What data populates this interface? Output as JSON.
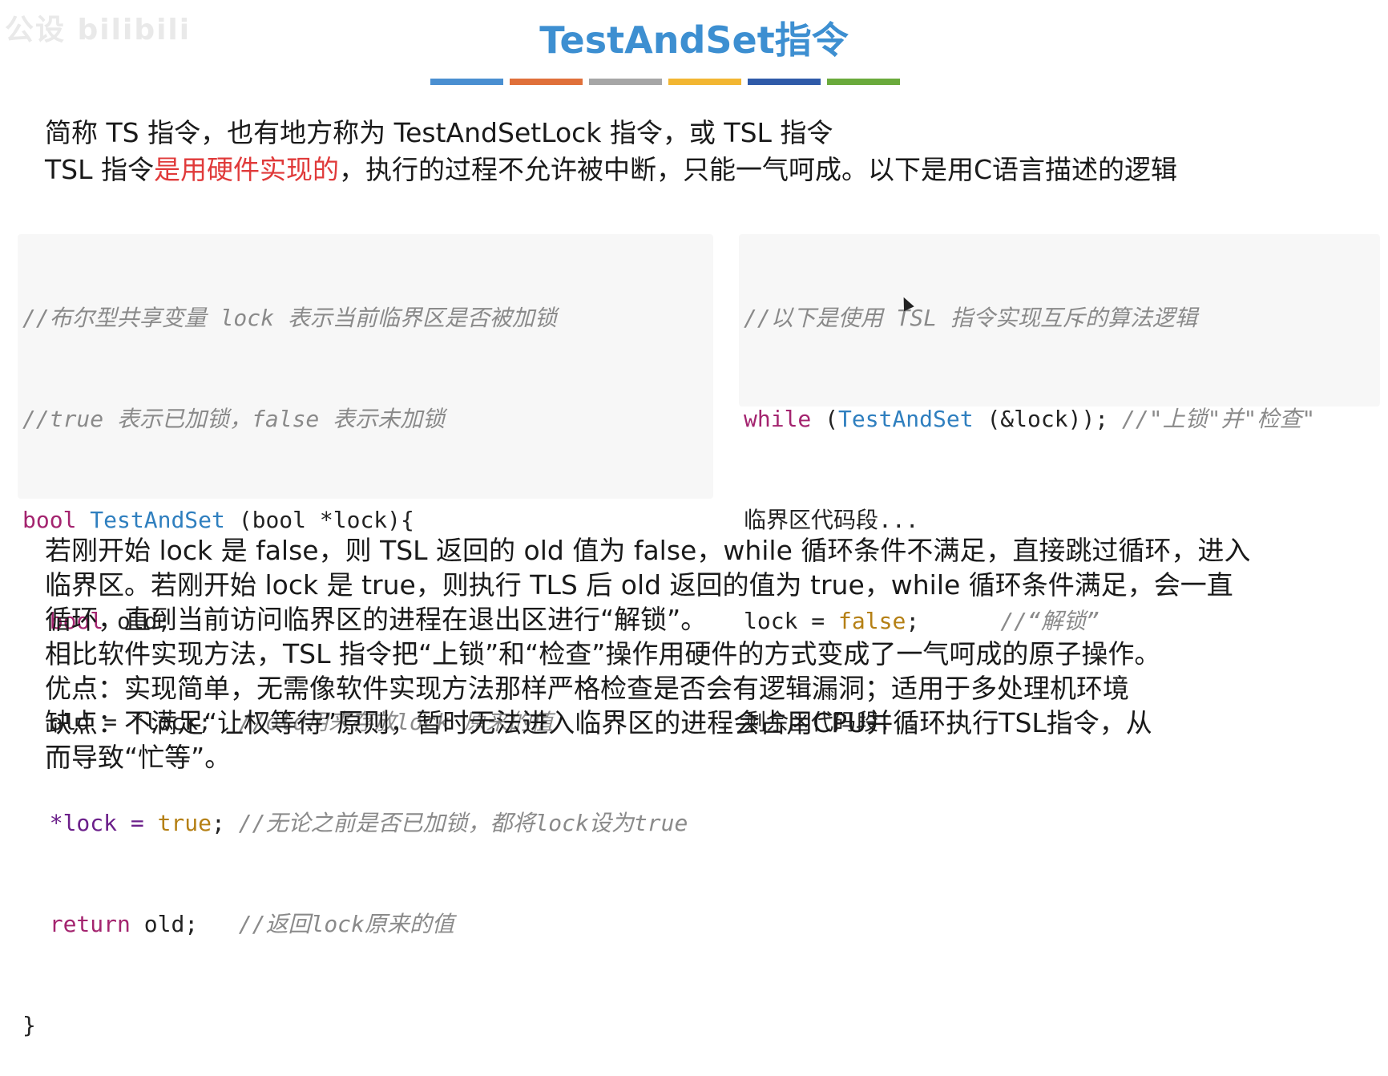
{
  "watermark": "公设 bilibili",
  "title": "TestAndSet指令",
  "color_bars": [
    "#4a8fd1",
    "#e0703a",
    "#a6a6a6",
    "#f2b632",
    "#2f5aa8",
    "#6aaa3c"
  ],
  "intro": {
    "line1": "简称 TS 指令，也有地方称为 TestAndSetLock 指令，或 TSL 指令",
    "line2_pre": "TSL 指令",
    "line2_red": "是用硬件实现的",
    "line2_post": "，执行的过程不允许被中断，只能一气呵成。以下是用C语言描述的逻辑"
  },
  "code_left": {
    "c1": "//布尔型共享变量 lock 表示当前临界区是否被加锁",
    "c2": "//true 表示已加锁，false 表示未加锁",
    "l3_type": "bool",
    "l3_fn": "TestAndSet",
    "l3_rest": " (bool *lock){",
    "l4_type": "bool",
    "l4_rest": " old;",
    "l5_code": "old = *lock;",
    "l5_cmt": "//old用来存放lock 原来的值",
    "l6_op": "*lock = ",
    "l6_lit": "true",
    "l6_semi": ";",
    "l6_cmt": "//无论之前是否已加锁，都将lock设为true",
    "l7_kw": "return",
    "l7_rest": " old;",
    "l7_cmt": "//返回lock原来的值",
    "l8": "}"
  },
  "code_right": {
    "c1": "//以下是使用 TSL 指令实现互斥的算法逻辑",
    "l2_kw": "while",
    "l2_open": " (",
    "l2_fn": "TestAndSet",
    "l2_rest": " (&lock));",
    "l2_cmt": "//\"上锁\"并\"检查\"",
    "l3": "临界区代码段...",
    "l4_code": "lock = ",
    "l4_lit": "false",
    "l4_semi": ";",
    "l4_cmt": "//“解锁”",
    "l5": "剩余区代码段..."
  },
  "body": {
    "p1": "若刚开始 lock 是 false，则 TSL 返回的 old 值为 false，while 循环条件不满足，直接跳过循环，进入",
    "p2": "临界区。若刚开始 lock 是 true，则执行 TLS 后 old 返回的值为 true，while 循环条件满足，会一直",
    "p3": "循环，直到当前访问临界区的进程在退出区进行“解锁”。",
    "p4": "相比软件实现方法，TSL 指令把“上锁”和“检查”操作用硬件的方式变成了一气呵成的原子操作。",
    "p5": "优点：实现简单，无需像软件实现方法那样严格检查是否会有逻辑漏洞；适用于多处理机环境",
    "p6": "缺点：不满足“让权等待”原则，暂时无法进入临界区的进程会占用CPU并循环执行TSL指令，从",
    "p7": "而导致“忙等”。"
  }
}
